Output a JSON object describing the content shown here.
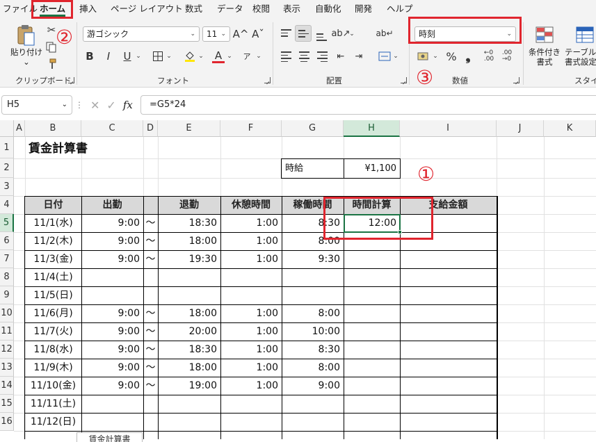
{
  "menu": {
    "tabs": [
      "ファイル",
      "ホーム",
      "挿入",
      "ページ レイアウト",
      "数式",
      "データ",
      "校閲",
      "表示",
      "自動化",
      "開発",
      "ヘルプ"
    ],
    "active": "ホーム"
  },
  "ribbon": {
    "clipboard": {
      "paste_label": "貼り付け",
      "paste_arrow": "⌄",
      "group_label": "クリップボード"
    },
    "font": {
      "font_name": "游ゴシック",
      "font_size": "11",
      "grow": "A^",
      "shrink": "Aˇ",
      "bold": "B",
      "italic": "I",
      "underline": "U",
      "font_color_letter": "A",
      "phonetic": "ア",
      "group_label": "フォント"
    },
    "alignment": {
      "group_label": "配置"
    },
    "number": {
      "format_value": "時刻",
      "percent": "%",
      "comma": "❟",
      "group_label": "数値"
    },
    "styles": {
      "conditional_line1": "条件付き",
      "conditional_line2": "書式",
      "table_line1": "テーブルと",
      "table_line2": "書式設定",
      "group_label": "スタイル"
    }
  },
  "formula_bar": {
    "name_box": "H5",
    "formula": "=G5*24",
    "fx": "fx"
  },
  "grid": {
    "columns": [
      "A",
      "B",
      "C",
      "D",
      "E",
      "F",
      "G",
      "H",
      "I",
      "J",
      "K"
    ],
    "rows": [
      "1",
      "2",
      "3",
      "4",
      "5",
      "6",
      "7",
      "8",
      "9",
      "10",
      "11",
      "12",
      "13",
      "14",
      "15",
      "16"
    ],
    "title": "賃金計算書",
    "wage_label": "時給",
    "wage_value": "¥1,100",
    "headers": [
      "日付",
      "出勤",
      "退勤",
      "休憩時間",
      "稼働時間",
      "時間計算",
      "支給金額"
    ],
    "tilde": "～",
    "data_rows": [
      {
        "date": "11/1(水)",
        "in": "9:00",
        "tilde": "～",
        "out": "18:30",
        "break": "1:00",
        "work": "8:30",
        "calc": "12:00"
      },
      {
        "date": "11/2(木)",
        "in": "9:00",
        "tilde": "～",
        "out": "18:00",
        "break": "1:00",
        "work": "8:00",
        "calc": ""
      },
      {
        "date": "11/3(金)",
        "in": "9:00",
        "tilde": "～",
        "out": "19:30",
        "break": "1:00",
        "work": "9:30",
        "calc": ""
      },
      {
        "date": "11/4(土)",
        "in": "",
        "tilde": "",
        "out": "",
        "break": "",
        "work": "",
        "calc": ""
      },
      {
        "date": "11/5(日)",
        "in": "",
        "tilde": "",
        "out": "",
        "break": "",
        "work": "",
        "calc": ""
      },
      {
        "date": "11/6(月)",
        "in": "9:00",
        "tilde": "～",
        "out": "18:00",
        "break": "1:00",
        "work": "8:00",
        "calc": ""
      },
      {
        "date": "11/7(火)",
        "in": "9:00",
        "tilde": "～",
        "out": "20:00",
        "break": "1:00",
        "work": "10:00",
        "calc": ""
      },
      {
        "date": "11/8(水)",
        "in": "9:00",
        "tilde": "～",
        "out": "18:30",
        "break": "1:00",
        "work": "8:30",
        "calc": ""
      },
      {
        "date": "11/9(木)",
        "in": "9:00",
        "tilde": "～",
        "out": "18:00",
        "break": "1:00",
        "work": "8:00",
        "calc": ""
      },
      {
        "date": "11/10(金)",
        "in": "9:00",
        "tilde": "～",
        "out": "19:00",
        "break": "1:00",
        "work": "9:00",
        "calc": ""
      },
      {
        "date": "11/11(土)",
        "in": "",
        "tilde": "",
        "out": "",
        "break": "",
        "work": "",
        "calc": ""
      },
      {
        "date": "11/12(日)",
        "in": "",
        "tilde": "",
        "out": "",
        "break": "",
        "work": "",
        "calc": ""
      }
    ]
  },
  "annotations": {
    "n1": "①",
    "n2": "②",
    "n3": "③"
  },
  "sheet_tab": "賃金計算書",
  "colors": {
    "accent": "#1a7343",
    "annotation": "#e0252e",
    "header_fill": "#d9d9d9"
  }
}
